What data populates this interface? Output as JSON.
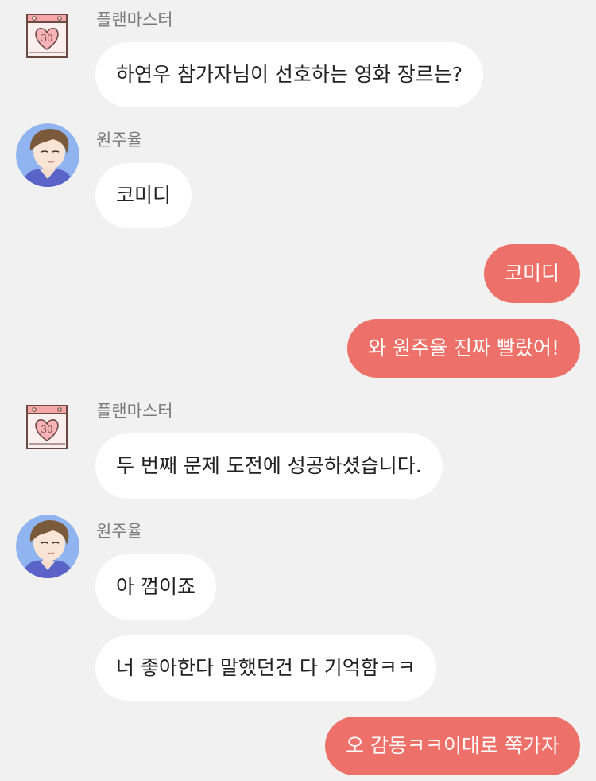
{
  "colors": {
    "background": "#f1f1f1",
    "incoming_bubble": "#ffffff",
    "outgoing_bubble": "#ee7169",
    "sender_name": "#7a7a7a"
  },
  "calendar_icon_number": "30",
  "messages": [
    {
      "direction": "incoming",
      "sender": "플랜마스터",
      "avatar": "calendar-heart-icon",
      "text": "하연우 참가자님이 선호하는 영화 장르는?"
    },
    {
      "direction": "incoming",
      "sender": "원주율",
      "avatar": "person-avatar",
      "text": "코미디"
    },
    {
      "direction": "outgoing",
      "text": "코미디"
    },
    {
      "direction": "outgoing",
      "text": "와 원주율 진짜 빨랐어!"
    },
    {
      "direction": "incoming",
      "sender": "플랜마스터",
      "avatar": "calendar-heart-icon",
      "text": "두 번째 문제 도전에 성공하셨습니다."
    },
    {
      "direction": "incoming",
      "sender": "원주율",
      "avatar": "person-avatar",
      "text": "아 껌이죠"
    },
    {
      "direction": "incoming",
      "sender": "원주율",
      "avatar": "none",
      "text": "너 좋아한다 말했던건 다 기억함ㅋㅋ"
    },
    {
      "direction": "outgoing",
      "text": "오 감동ㅋㅋ이대로 쭉가자"
    }
  ]
}
